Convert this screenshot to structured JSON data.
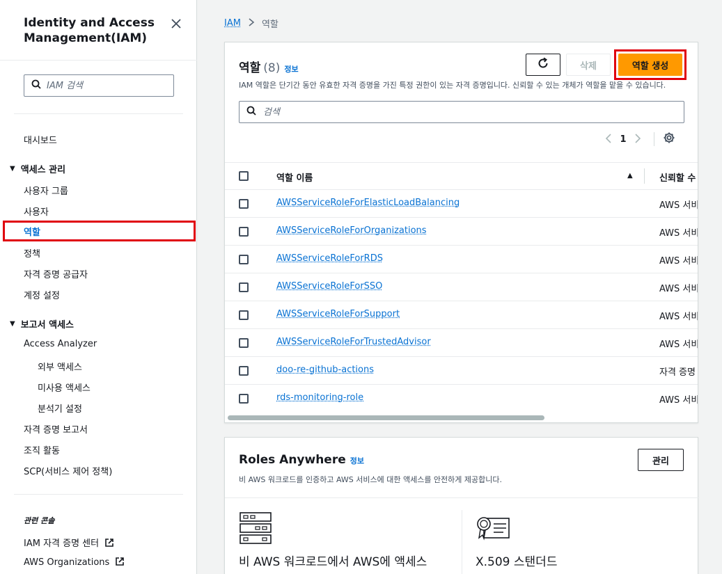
{
  "sidebar": {
    "title": "Identity and Access Management(IAM)",
    "search_placeholder": "IAM 검색",
    "dashboard": "대시보드",
    "access_mgmt": {
      "label": "액세스 관리",
      "items": [
        "사용자 그룹",
        "사용자",
        "역할",
        "정책",
        "자격 증명 공급자",
        "계정 설정"
      ]
    },
    "reports": {
      "label": "보고서 액세스",
      "analyzer": "Access Analyzer",
      "analyzer_items": [
        "외부 액세스",
        "미사용 액세스",
        "분석기 설정"
      ],
      "items": [
        "자격 증명 보고서",
        "조직 활동",
        "SCP(서비스 제어 정책)"
      ]
    },
    "related_label": "관련 콘솔",
    "related": [
      "IAM 자격 증명 센터",
      "AWS Organizations"
    ]
  },
  "breadcrumb": {
    "root": "IAM",
    "current": "역할"
  },
  "roles": {
    "title": "역할",
    "count": "(8)",
    "info": "정보",
    "description": "IAM 역할은 단기간 동안 유효한 자격 증명을 가진 특정 권한이 있는 자격 증명입니다. 신뢰할 수 있는 개체가 역할을 맡을 수 있습니다.",
    "delete_label": "삭제",
    "create_label": "역할 생성",
    "search_placeholder": "검색",
    "page": "1",
    "col_name": "역할 이름",
    "col_trust": "신뢰할 수",
    "rows": [
      {
        "name": "AWSServiceRoleForElasticLoadBalancing",
        "trust": "AWS 서비"
      },
      {
        "name": "AWSServiceRoleForOrganizations",
        "trust": "AWS 서비"
      },
      {
        "name": "AWSServiceRoleForRDS",
        "trust": "AWS 서비"
      },
      {
        "name": "AWSServiceRoleForSSO",
        "trust": "AWS 서비"
      },
      {
        "name": "AWSServiceRoleForSupport",
        "trust": "AWS 서비"
      },
      {
        "name": "AWSServiceRoleForTrustedAdvisor",
        "trust": "AWS 서비"
      },
      {
        "name": "doo-re-github-actions",
        "trust": "자격 증명"
      },
      {
        "name": "rds-monitoring-role",
        "trust": "AWS 서비"
      }
    ]
  },
  "roles_anywhere": {
    "title": "Roles Anywhere",
    "info": "정보",
    "description": "비 AWS 워크로드를 인증하고 AWS 서비스에 대한 액세스를 안전하게 제공합니다.",
    "manage_label": "관리",
    "features": [
      "비 AWS 워크로드에서 AWS에 액세스",
      "X.509 스탠더드"
    ]
  },
  "colors": {
    "accent": "#0972d3",
    "primary_button": "#ff9900",
    "highlight": "#e0000d"
  }
}
